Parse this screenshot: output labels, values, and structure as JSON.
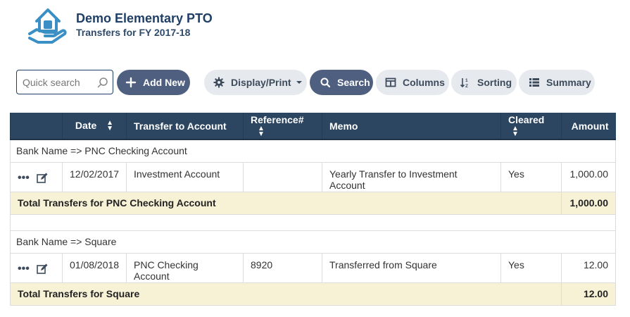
{
  "header": {
    "org_name": "Demo Elementary PTO",
    "subtitle": "Transfers for FY 2017-18"
  },
  "toolbar": {
    "search_placeholder": "Quick search",
    "add_new": "Add New",
    "display_print": "Display/Print",
    "search": "Search",
    "columns": "Columns",
    "sorting": "Sorting",
    "summary": "Summary"
  },
  "table": {
    "columns": [
      "Date",
      "Transfer to Account",
      "Reference#",
      "Memo",
      "Cleared",
      "Amount"
    ],
    "groups": [
      {
        "label": "Bank Name => PNC Checking Account",
        "rows": [
          {
            "date": "12/02/2017",
            "account": "Investment Account",
            "reference": "",
            "memo": "Yearly Transfer to Investment Account",
            "cleared": "Yes",
            "amount": "1,000.00"
          }
        ],
        "total_label": "Total Transfers for PNC Checking Account",
        "total_amount": "1,000.00"
      },
      {
        "label": "Bank Name => Square",
        "rows": [
          {
            "date": "01/08/2018",
            "account": "PNC Checking Account",
            "reference": "8920",
            "memo": "Transferred from Square",
            "cleared": "Yes",
            "amount": "12.00"
          }
        ],
        "total_label": "Total Transfers for Square",
        "total_amount": "12.00"
      }
    ]
  },
  "colors": {
    "header_bg": "#2c4560",
    "brand": "#1f3f66",
    "accent_button": "#4f5f80",
    "total_row_bg": "#f7f2d6",
    "logo": "#3a8fc4"
  },
  "icons": [
    "house-hand-logo",
    "search-icon",
    "plus-icon",
    "gear-icon",
    "caret-down-icon",
    "columns-icon",
    "sort-icon",
    "list-icon",
    "more-icon",
    "edit-icon",
    "sort-arrows-icon"
  ]
}
